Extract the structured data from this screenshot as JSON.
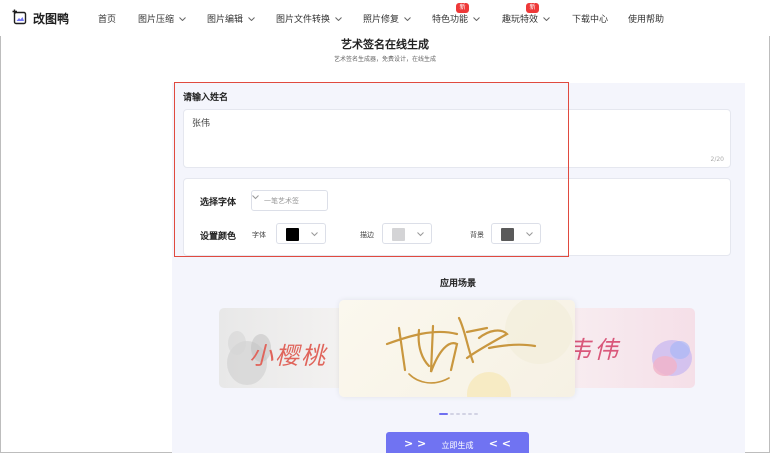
{
  "app": {
    "name": "改图鸭"
  },
  "nav": {
    "items": [
      {
        "label": "首页",
        "has_menu": false
      },
      {
        "label": "图片压缩",
        "has_menu": true
      },
      {
        "label": "图片编辑",
        "has_menu": true
      },
      {
        "label": "图片文件转换",
        "has_menu": true
      },
      {
        "label": "照片修复",
        "has_menu": true
      },
      {
        "label": "特色功能",
        "has_menu": true,
        "badge": "新"
      },
      {
        "label": "趣玩特效",
        "has_menu": true,
        "badge": "新"
      },
      {
        "label": "下载中心",
        "has_menu": false
      },
      {
        "label": "使用帮助",
        "has_menu": false
      }
    ]
  },
  "page": {
    "title": "艺术签名在线生成",
    "subtitle": "艺术签名生成器，免费设计，在线生成"
  },
  "form": {
    "name_label": "请输入姓名",
    "name_value": "张伟",
    "char_count": "2/20",
    "font_label": "选择字体",
    "font_value": "一笔艺术签",
    "color_label": "设置颜色",
    "colors": [
      {
        "label": "字体",
        "value": "#000000"
      },
      {
        "label": "描边",
        "value": "#d4d4d6"
      },
      {
        "label": "背景",
        "value": "#5a5a5a"
      }
    ]
  },
  "scenes": {
    "title": "应用场景",
    "left_text": "小樱桃",
    "right_text": "韦伟",
    "dots_count": 6,
    "active_dot": 0
  },
  "actions": {
    "generate_label": "立即生成"
  },
  "colors": {
    "accent": "#7073f2",
    "highlight": "#e04a3f",
    "panel_bg": "#f4f5fc",
    "badge": "#ee3838"
  }
}
